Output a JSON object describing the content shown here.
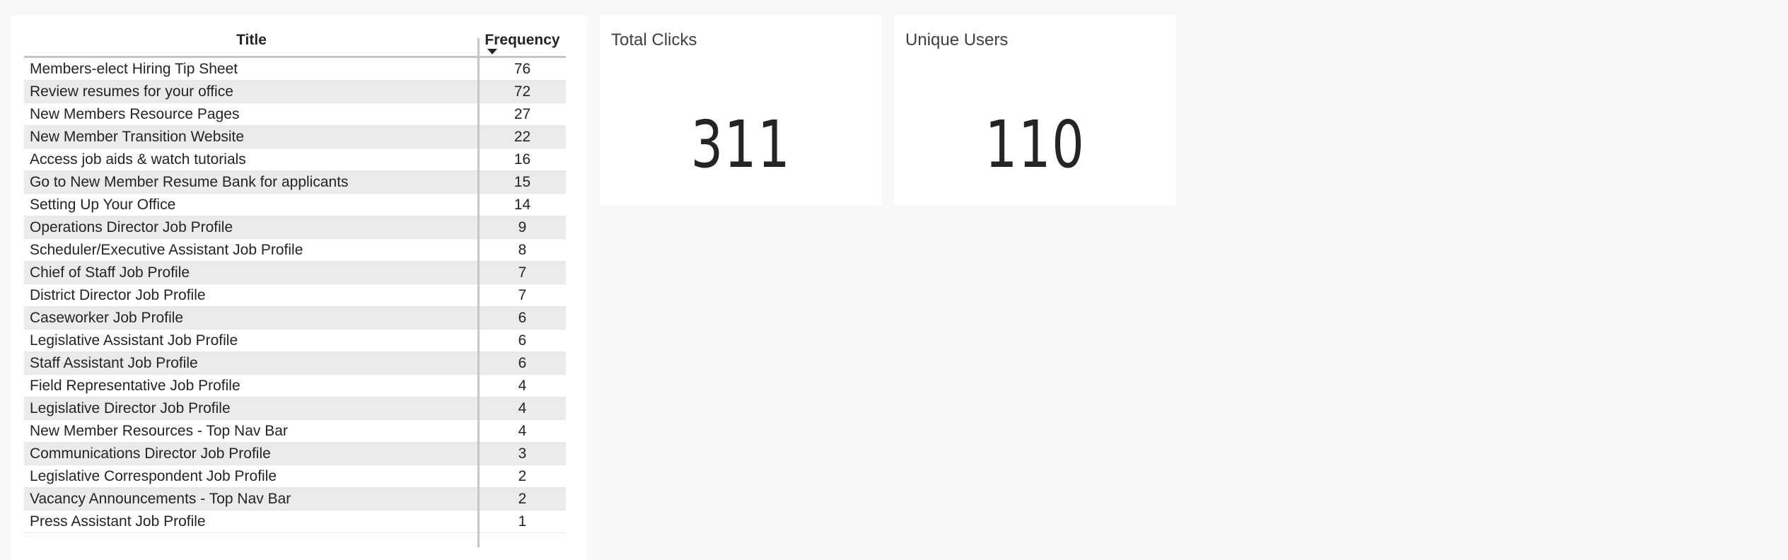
{
  "table": {
    "columns": {
      "title": "Title",
      "frequency": "Frequency"
    },
    "sort": {
      "column": "Frequency",
      "direction": "descending"
    },
    "rows": [
      {
        "title": "Members-elect Hiring Tip Sheet",
        "frequency": "76"
      },
      {
        "title": "Review resumes for your office",
        "frequency": "72"
      },
      {
        "title": "New Members Resource Pages",
        "frequency": "27"
      },
      {
        "title": "New Member Transition Website",
        "frequency": "22"
      },
      {
        "title": "Access job aids & watch tutorials",
        "frequency": "16"
      },
      {
        "title": "Go to New Member Resume Bank for applicants",
        "frequency": "15"
      },
      {
        "title": "Setting Up Your Office",
        "frequency": "14"
      },
      {
        "title": "Operations Director Job Profile",
        "frequency": "9"
      },
      {
        "title": "Scheduler/Executive Assistant Job Profile",
        "frequency": "8"
      },
      {
        "title": "Chief of Staff Job Profile",
        "frequency": "7"
      },
      {
        "title": "District Director Job Profile",
        "frequency": "7"
      },
      {
        "title": "Caseworker Job Profile",
        "frequency": "6"
      },
      {
        "title": "Legislative Assistant Job Profile",
        "frequency": "6"
      },
      {
        "title": "Staff Assistant Job Profile",
        "frequency": "6"
      },
      {
        "title": "Field Representative Job Profile",
        "frequency": "4"
      },
      {
        "title": "Legislative Director Job Profile",
        "frequency": "4"
      },
      {
        "title": "New Member Resources - Top Nav Bar",
        "frequency": "4"
      },
      {
        "title": "Communications Director Job Profile",
        "frequency": "3"
      },
      {
        "title": "Legislative Correspondent Job Profile",
        "frequency": "2"
      },
      {
        "title": "Vacancy Announcements - Top Nav Bar",
        "frequency": "2"
      },
      {
        "title": "Press Assistant Job Profile",
        "frequency": "1"
      }
    ]
  },
  "cards": {
    "total_clicks": {
      "label": "Total Clicks",
      "value": "311"
    },
    "unique_users": {
      "label": "Unique Users",
      "value": "110"
    }
  },
  "colors": {
    "canvas": "#f8f7f6",
    "visual_bg": "#ffffff",
    "row_alt": "#ebebeb",
    "text": "#252423",
    "header_rule": "#c8c6c4"
  },
  "icons": {
    "sort_indicator": "sort-descending-icon"
  }
}
